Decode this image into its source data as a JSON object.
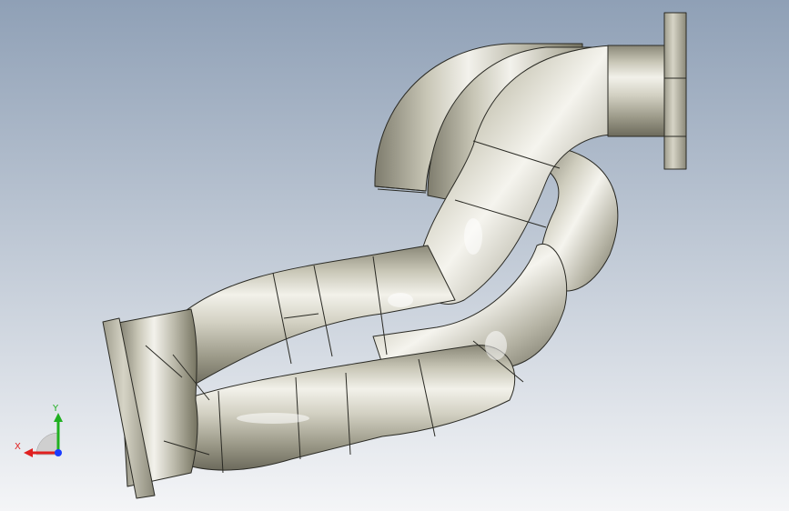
{
  "viewport": {
    "background_top": "#8fa0b6",
    "background_bottom": "#f4f5f7",
    "model_color": "#c9c7b8"
  },
  "triad": {
    "x_label": "X",
    "y_label": "Y",
    "x_color": "#e02020",
    "y_color": "#20b020",
    "z_color": "#1a3cff",
    "icon": "coordinate-triad-icon"
  }
}
